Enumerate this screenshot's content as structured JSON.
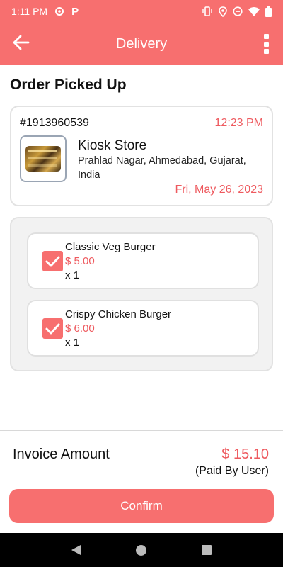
{
  "status_bar": {
    "time": "1:11 PM",
    "left_icons": [
      "settings-icon",
      "p-app-icon"
    ],
    "p_glyph": "P",
    "right_icons": [
      "vibrate-icon",
      "location-icon",
      "dnd-icon",
      "wifi-icon",
      "battery-icon"
    ]
  },
  "app_bar": {
    "title": "Delivery",
    "back_icon": "arrow-left-icon",
    "menu_icon": "more-vertical-icon"
  },
  "page": {
    "section_title": "Order Picked Up"
  },
  "order": {
    "id": "#1913960539",
    "time": "12:23 PM",
    "store_name": "Kiosk Store",
    "store_address": "Prahlad Nagar, Ahmedabad, Gujarat, India",
    "date": "Fri, May 26, 2023"
  },
  "items": [
    {
      "name": "Classic Veg Burger",
      "price": "$ 5.00",
      "qty": "x  1",
      "checked": true
    },
    {
      "name": "Crispy Chicken Burger",
      "price": "$ 6.00",
      "qty": "x  1",
      "checked": true
    }
  ],
  "invoice": {
    "label": "Invoice Amount",
    "amount": "$ 15.10",
    "note": "(Paid By User)"
  },
  "actions": {
    "confirm_label": "Confirm"
  },
  "nav_bar": {
    "icons": [
      "nav-back-icon",
      "nav-home-icon",
      "nav-recents-icon"
    ]
  },
  "colors": {
    "accent": "#f76f6f",
    "accent_text": "#ee5a5f",
    "panel_bg": "#f2f2f2"
  }
}
